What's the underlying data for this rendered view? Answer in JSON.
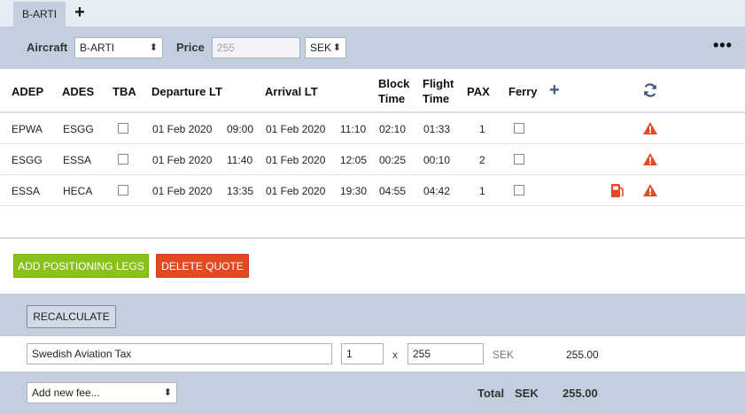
{
  "tabs": [
    {
      "label": "B-ARTI"
    }
  ],
  "header": {
    "aircraft_label": "Aircraft",
    "aircraft_value": "B-ARTI",
    "price_label": "Price",
    "price_placeholder": "255",
    "currency_value": "SEK",
    "more_label": "•••"
  },
  "table": {
    "headers": {
      "adep": "ADEP",
      "ades": "ADES",
      "tba": "TBA",
      "departure": "Departure LT",
      "arrival": "Arrival LT",
      "block_line1": "Block",
      "block_line2": "Time",
      "flight_line1": "Flight",
      "flight_line2": "Time",
      "pax": "PAX",
      "ferry": "Ferry",
      "add": "+"
    },
    "rows": [
      {
        "adep": "EPWA",
        "ades": "ESGG",
        "dep_date": "01 Feb 2020",
        "dep_time": "09:00",
        "arr_date": "01 Feb 2020",
        "arr_time": "11:10",
        "block": "02:10",
        "flight": "01:33",
        "pax": "1",
        "tba": false,
        "ferry": false,
        "fuel_icon": false,
        "warning_icon": true
      },
      {
        "adep": "ESGG",
        "ades": "ESSA",
        "dep_date": "01 Feb 2020",
        "dep_time": "11:40",
        "arr_date": "01 Feb 2020",
        "arr_time": "12:05",
        "block": "00:25",
        "flight": "00:10",
        "pax": "2",
        "tba": false,
        "ferry": false,
        "fuel_icon": false,
        "warning_icon": true
      },
      {
        "adep": "ESSA",
        "ades": "HECA",
        "dep_date": "01 Feb 2020",
        "dep_time": "13:35",
        "arr_date": "01 Feb 2020",
        "arr_time": "19:30",
        "block": "04:55",
        "flight": "04:42",
        "pax": "1",
        "tba": false,
        "ferry": false,
        "fuel_icon": true,
        "warning_icon": true
      }
    ]
  },
  "actions": {
    "add_positioning": "ADD POSITIONING LEGS",
    "delete_quote": "DELETE QUOTE",
    "recalculate": "RECALCULATE"
  },
  "fees": [
    {
      "name": "Swedish Aviation Tax",
      "quantity": "1",
      "times": "x",
      "unit_price": "255",
      "currency": "SEK",
      "amount": "255.00"
    }
  ],
  "footer": {
    "add_fee_placeholder": "Add new fee...",
    "total_label": "Total",
    "total_currency": "SEK",
    "total_value": "255.00"
  },
  "colors": {
    "band": "#c3cfdf",
    "green_button": "#8bc21a",
    "red_button": "#e44a22",
    "warning": "#e44a22",
    "accent_icon": "#3c5a86"
  }
}
